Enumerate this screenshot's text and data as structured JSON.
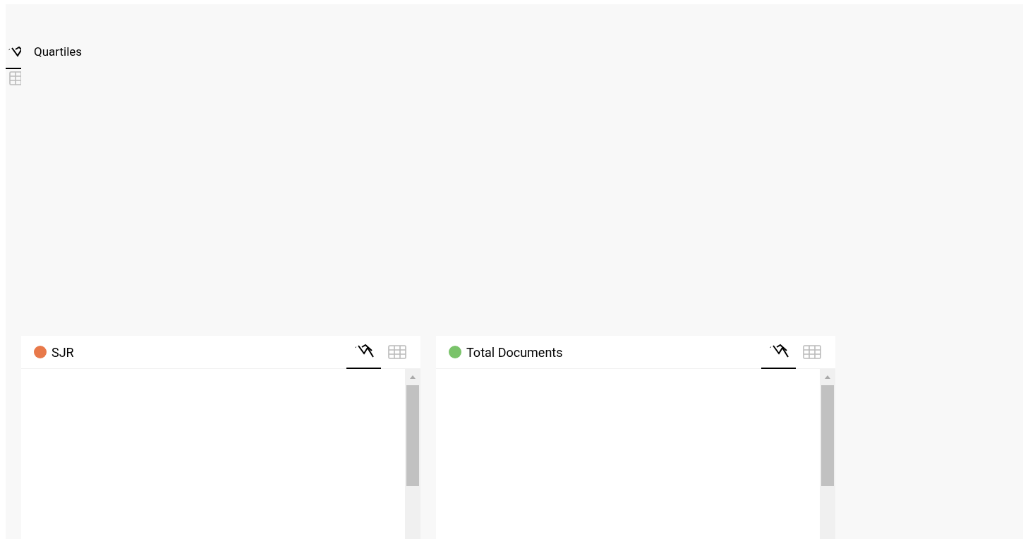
{
  "quartiles": {
    "title": "Quartiles",
    "view_tabs": [
      {
        "kind": "chart",
        "selected": true
      },
      {
        "kind": "table",
        "selected": false
      }
    ]
  },
  "panels": [
    {
      "title": "SJR",
      "color": "#e8794a",
      "view_tabs": [
        {
          "kind": "chart",
          "selected": true
        },
        {
          "kind": "table",
          "selected": false
        }
      ]
    },
    {
      "title": "Total Documents",
      "color": "#7ac36a",
      "view_tabs": [
        {
          "kind": "chart",
          "selected": true
        },
        {
          "kind": "table",
          "selected": false
        }
      ]
    }
  ]
}
